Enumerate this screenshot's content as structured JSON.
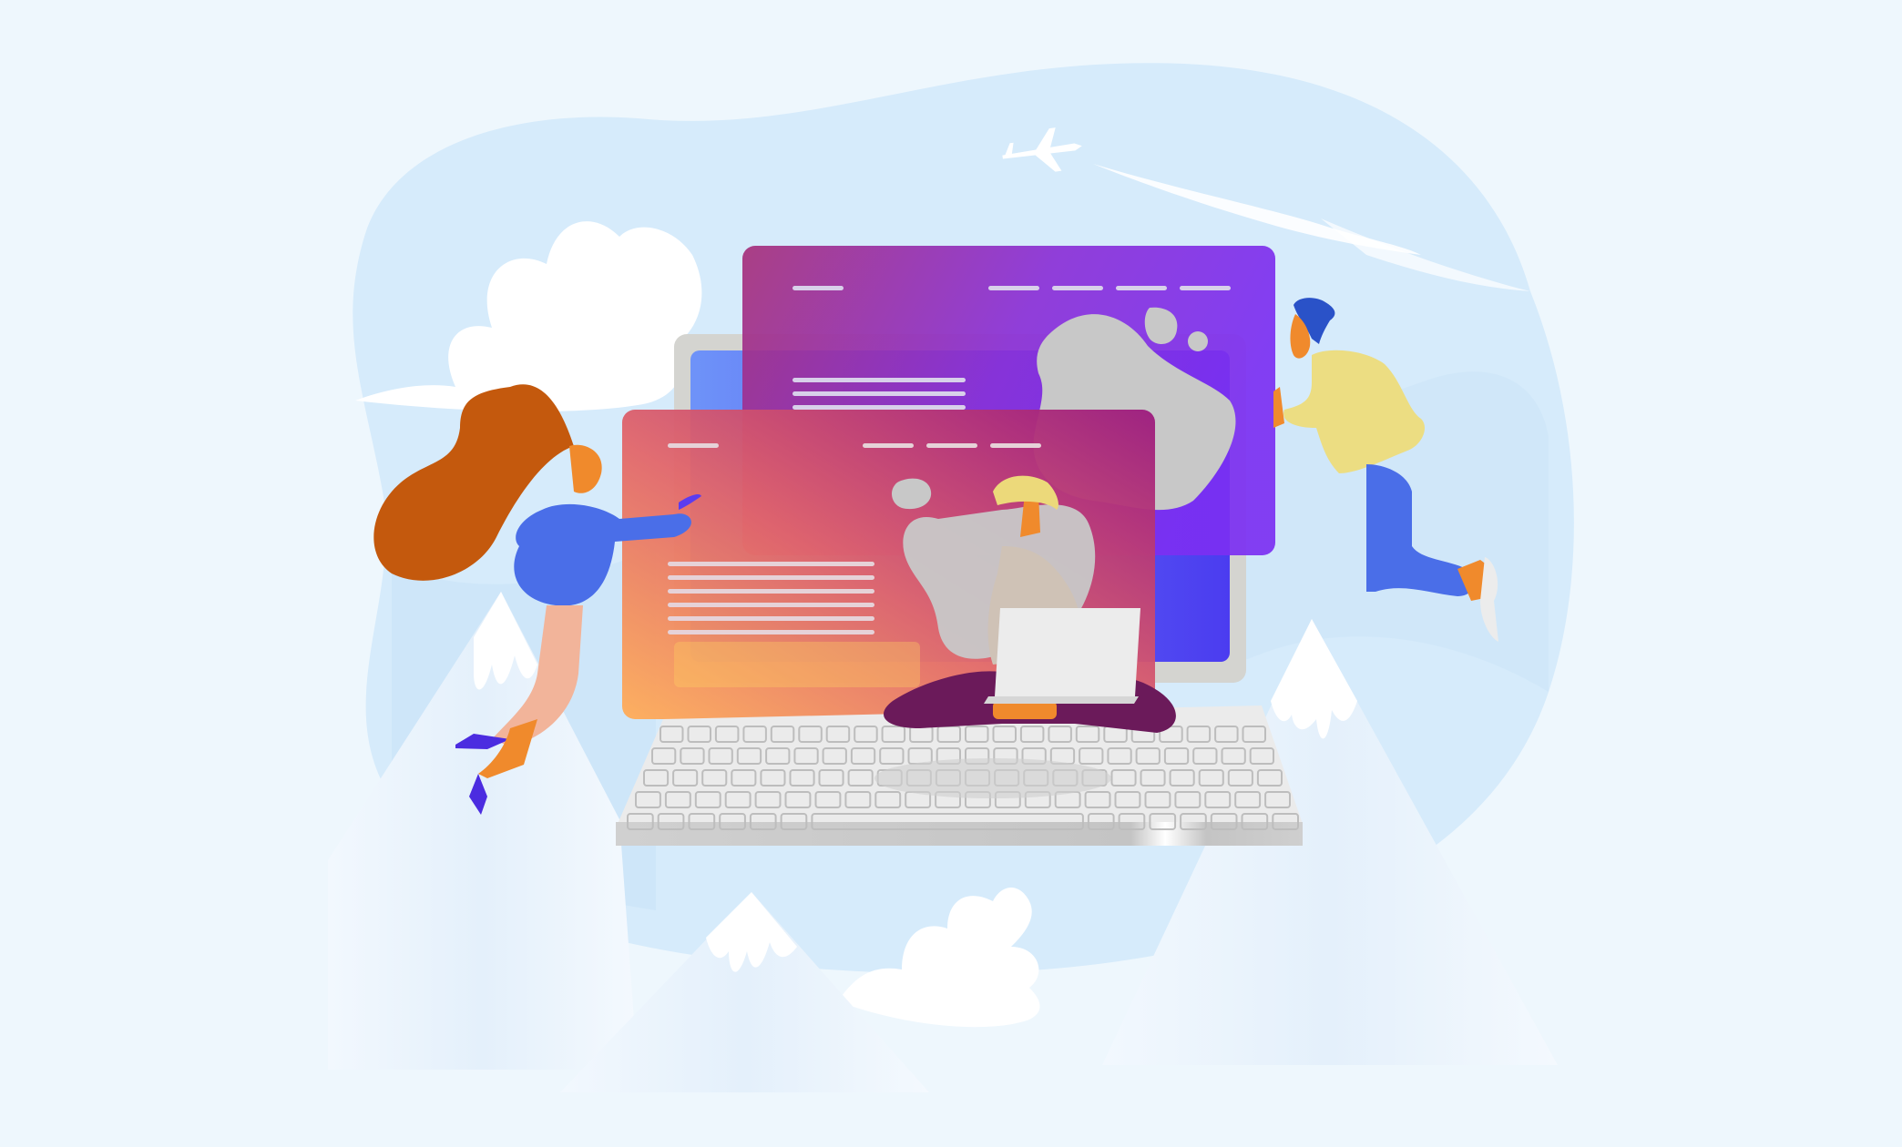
{
  "scene": {
    "type": "flat vector illustration",
    "colors": {
      "background": "#eef7fd",
      "sky_blob": "#d6ebfb",
      "mountain": "#e8f3fc",
      "snow": "#ffffff",
      "back_window_gradient": [
        "#a6307a",
        "#7b2ff2"
      ],
      "front_window_gradient": [
        "#ffab54",
        "#b1197a"
      ],
      "keyboard": "#e9e9e9",
      "laptop_frame": "#d4d4d0"
    },
    "icons": [
      "airplane-icon",
      "cloud-icon",
      "mountain-icon",
      "laptop-icon",
      "keyboard-icon",
      "browser-window-icon"
    ],
    "figures": [
      "woman-flying-left",
      "man-flying-right",
      "person-sitting-with-laptop"
    ]
  }
}
